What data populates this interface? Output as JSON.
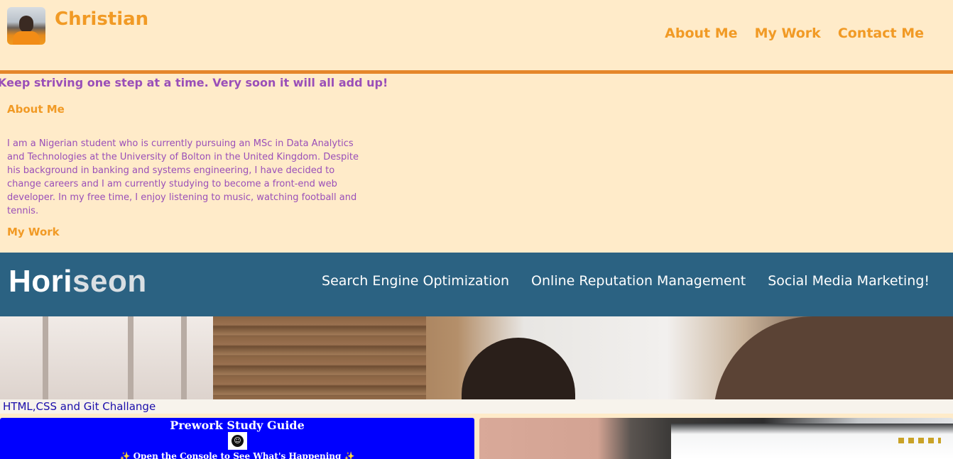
{
  "header": {
    "site_name": "Christian",
    "nav": [
      "About Me",
      "My Work",
      "Contact Me"
    ]
  },
  "tagline": "Keep striving one step at a time. Very soon it will all add up!",
  "about": {
    "heading": "About Me",
    "text": "I am a Nigerian student who is currently pursuing an MSc in Data Analytics and Technologies at the University of Bolton in the United Kingdom. Despite his background in banking and systems engineering, I have decided to change careers and I am currently studying to become a front-end web developer. In my free time, I enjoy listening to music, watching football and tennis."
  },
  "work": {
    "heading": "My Work",
    "horiseon": {
      "logo_a": "Hori",
      "logo_b": "seon",
      "nav": [
        "Search Engine Optimization",
        "Online Reputation Management",
        "Social Media Marketing!"
      ]
    },
    "project_link": "HTML,CSS and Git Challange",
    "prework": {
      "title": "Prework Study Guide",
      "subtitle": "✨ Open the Console to See What's Happening ✨"
    }
  },
  "colors": {
    "background": "#ffebc9",
    "accent_orange": "#f19a25",
    "rule_orange": "#e5862a",
    "purple_text": "#9a4fb8",
    "horiseon_blue": "#2b6282",
    "prework_blue": "#0000ff",
    "link_blue": "#1a0dab"
  }
}
